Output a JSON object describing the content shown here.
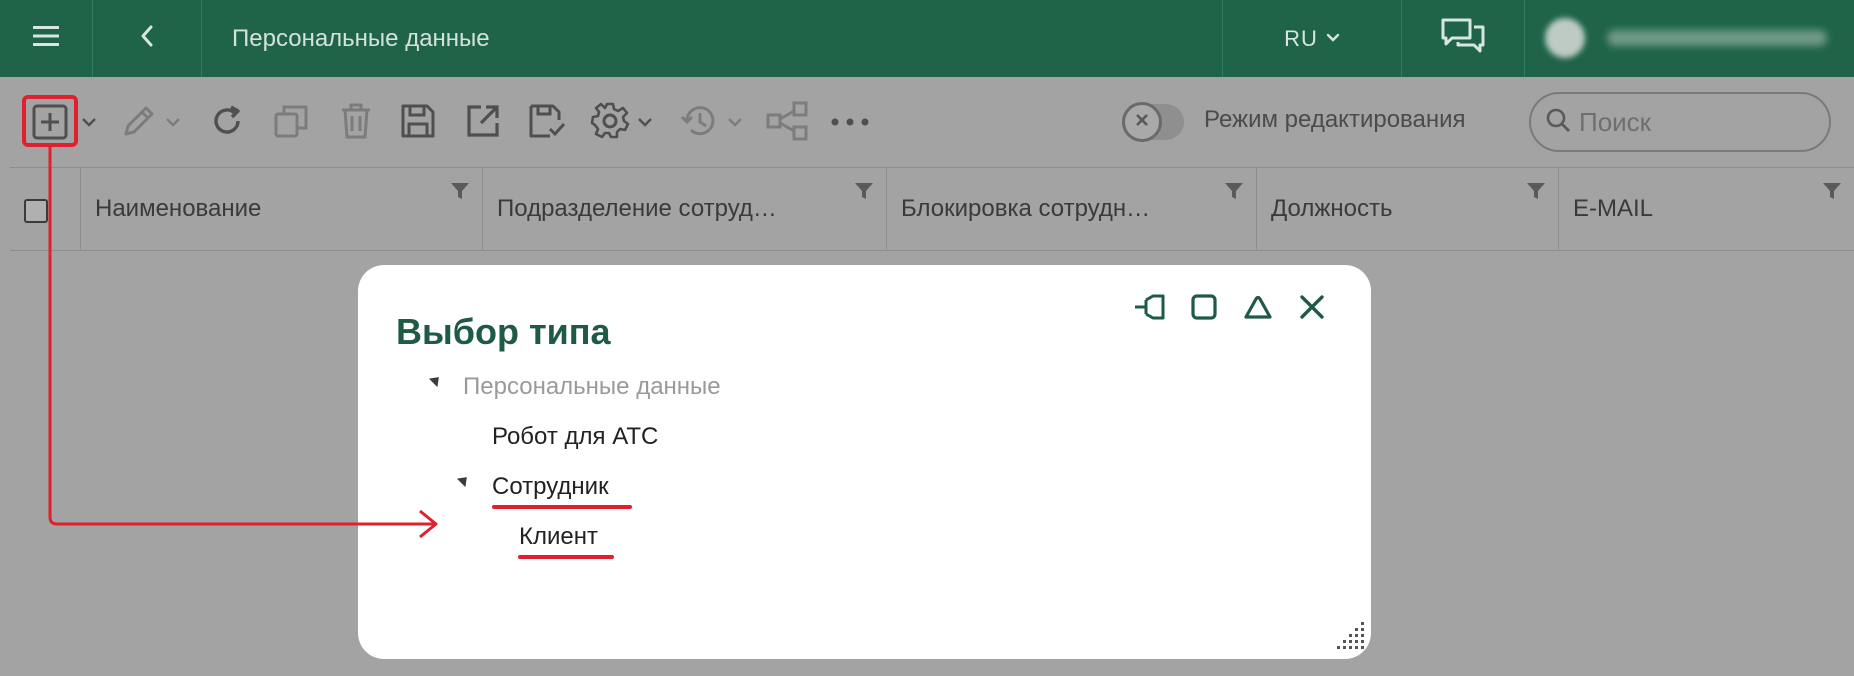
{
  "topbar": {
    "menu_icon": "hamburger-icon",
    "back_icon": "chevron-left-icon",
    "title": "Персональные данные",
    "language": "RU",
    "chat_icon": "chat-bubbles-icon",
    "bg_color": "#1f6448"
  },
  "toolbar": {
    "icons": [
      "add-icon",
      "edit-icon",
      "refresh-icon",
      "copy-icon",
      "delete-icon",
      "save-icon",
      "export-icon",
      "save-check-icon",
      "settings-icon",
      "history-icon",
      "share-icon",
      "more-icon"
    ],
    "edit_mode_label": "Режим редактирования",
    "search_placeholder": "Поиск"
  },
  "table": {
    "columns": [
      "Наименование",
      "Подразделение сотруд…",
      "Блокировка сотрудн…",
      "Должность",
      "E-MAIL"
    ]
  },
  "dialog": {
    "title": "Выбор типа",
    "controls": [
      "pin-icon",
      "maximize-icon",
      "collapse-icon",
      "close-icon"
    ],
    "tree": {
      "root": "Персональные данные",
      "items": [
        {
          "label": "Робот для АТС"
        },
        {
          "label": "Сотрудник",
          "children": [
            {
              "label": "Клиент"
            }
          ]
        }
      ]
    }
  },
  "annotation": {
    "highlight_color": "#e0202e"
  }
}
